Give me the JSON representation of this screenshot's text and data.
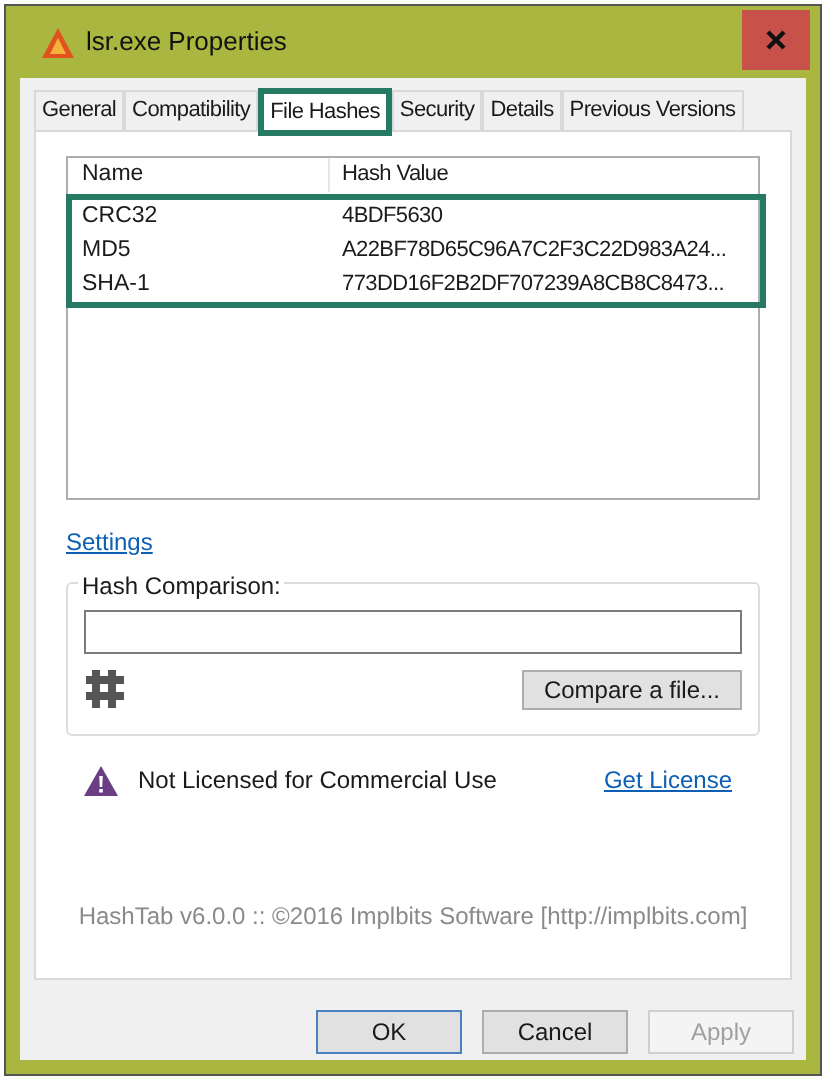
{
  "window": {
    "title": "lsr.exe Properties"
  },
  "tabs": [
    {
      "label": "General",
      "selected": false
    },
    {
      "label": "Compatibility",
      "selected": false
    },
    {
      "label": "File Hashes",
      "selected": true
    },
    {
      "label": "Security",
      "selected": false
    },
    {
      "label": "Details",
      "selected": false
    },
    {
      "label": "Previous Versions",
      "selected": false
    }
  ],
  "hash_list": {
    "columns": [
      "Name",
      "Hash Value"
    ],
    "rows": [
      [
        "CRC32",
        "4BDF5630"
      ],
      [
        "MD5",
        "A22BF78D65C96A7C2F3C22D983A24..."
      ],
      [
        "SHA-1",
        "773DD16F2B2DF707239A8CB8C8473..."
      ]
    ]
  },
  "settings_link": "Settings",
  "hash_comparison": {
    "label": "Hash Comparison:",
    "button": "Compare a file..."
  },
  "license": {
    "message": "Not Licensed for Commercial Use",
    "link": "Get License"
  },
  "footer": "HashTab v6.0.0 :: ©2016 Implbits Software [http://implbits.com]",
  "buttons": [
    {
      "label": "OK",
      "disabled": false
    },
    {
      "label": "Cancel",
      "disabled": false
    },
    {
      "label": "Apply",
      "disabled": true
    }
  ]
}
